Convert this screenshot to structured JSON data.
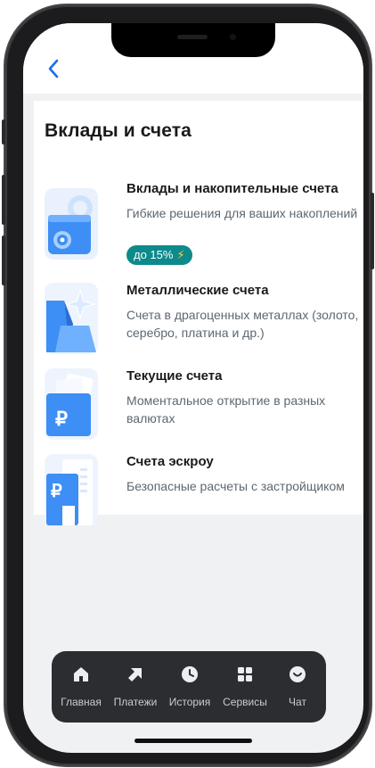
{
  "page": {
    "title": "Вклады и счета"
  },
  "items": [
    {
      "title": "Вклады и накопительные счета",
      "description": "Гибкие решения для ваших накоплений",
      "badge": "до 15%",
      "icon": "safe-icon"
    },
    {
      "title": "Металлические счета",
      "description": "Счета в драгоценных металлах (золото, серебро, платина и др.)",
      "icon": "metal-bars-icon"
    },
    {
      "title": "Текущие счета",
      "description": "Моментальное открытие в разных валютах",
      "icon": "ruble-cards-icon"
    },
    {
      "title": "Счета эскроу",
      "description": "Безопасные расчеты с застройщиком",
      "icon": "escrow-building-icon"
    }
  ],
  "tabbar": {
    "tabs": [
      {
        "label": "Главная",
        "icon": "home-icon"
      },
      {
        "label": "Платежи",
        "icon": "arrow-icon"
      },
      {
        "label": "История",
        "icon": "clock-icon"
      },
      {
        "label": "Сервисы",
        "icon": "grid-icon"
      },
      {
        "label": "Чат",
        "icon": "chat-icon"
      }
    ]
  },
  "colors": {
    "accent": "#1a6cf0",
    "badge": "#0d8a8c",
    "tabbar": "#2b2d30"
  }
}
